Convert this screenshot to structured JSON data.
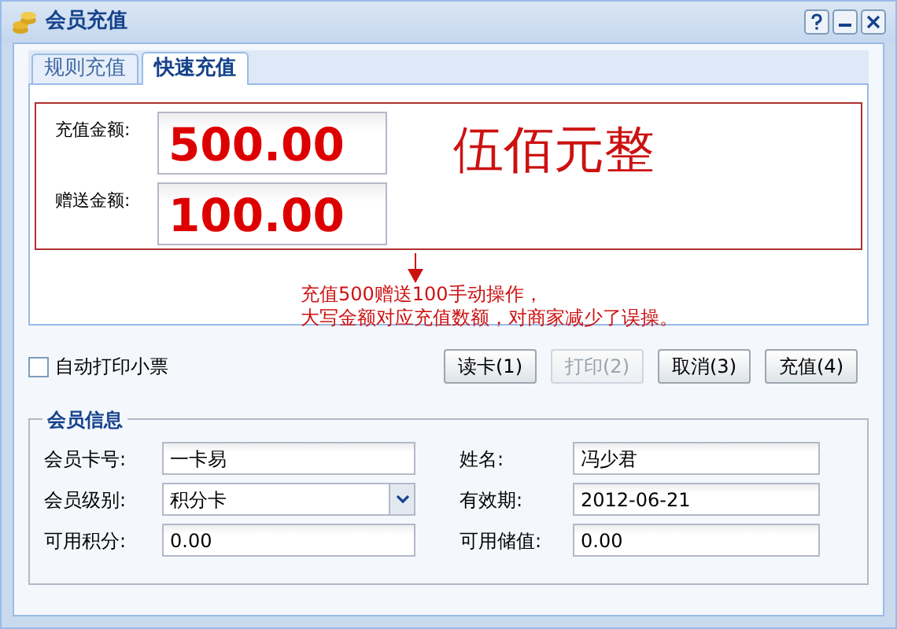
{
  "window": {
    "title": "会员充值"
  },
  "tabs": [
    {
      "label": "规则充值",
      "selected": false
    },
    {
      "label": "快速充值",
      "selected": true
    }
  ],
  "recharge": {
    "fields": [
      {
        "label": "充值金额:",
        "value": "500.00"
      },
      {
        "label": "赠送金额:",
        "value": "100.00"
      }
    ],
    "amount_in_words": "伍佰元整",
    "annotation": [
      "充值500赠送100手动操作，",
      "大写金额对应充值数额，对商家减少了误操。"
    ]
  },
  "auto_print": {
    "label": "自动打印小票",
    "checked": false
  },
  "buttons": [
    {
      "label": "读卡(1)",
      "disabled": false
    },
    {
      "label": "打印(2)",
      "disabled": true
    },
    {
      "label": "取消(3)",
      "disabled": false
    },
    {
      "label": "充值(4)",
      "disabled": false
    }
  ],
  "member_info": {
    "title": "会员信息",
    "fields": [
      {
        "label": "会员卡号:",
        "value": "一卡易",
        "kind": "text"
      },
      {
        "label": "姓名:",
        "value": "冯少君",
        "kind": "text"
      },
      {
        "label": "会员级别:",
        "value": "积分卡",
        "kind": "select"
      },
      {
        "label": "有效期:",
        "value": "2012-06-21",
        "kind": "text"
      },
      {
        "label": "可用积分:",
        "value": "0.00",
        "kind": "text"
      },
      {
        "label": "可用储值:",
        "value": "0.00",
        "kind": "text"
      }
    ]
  }
}
